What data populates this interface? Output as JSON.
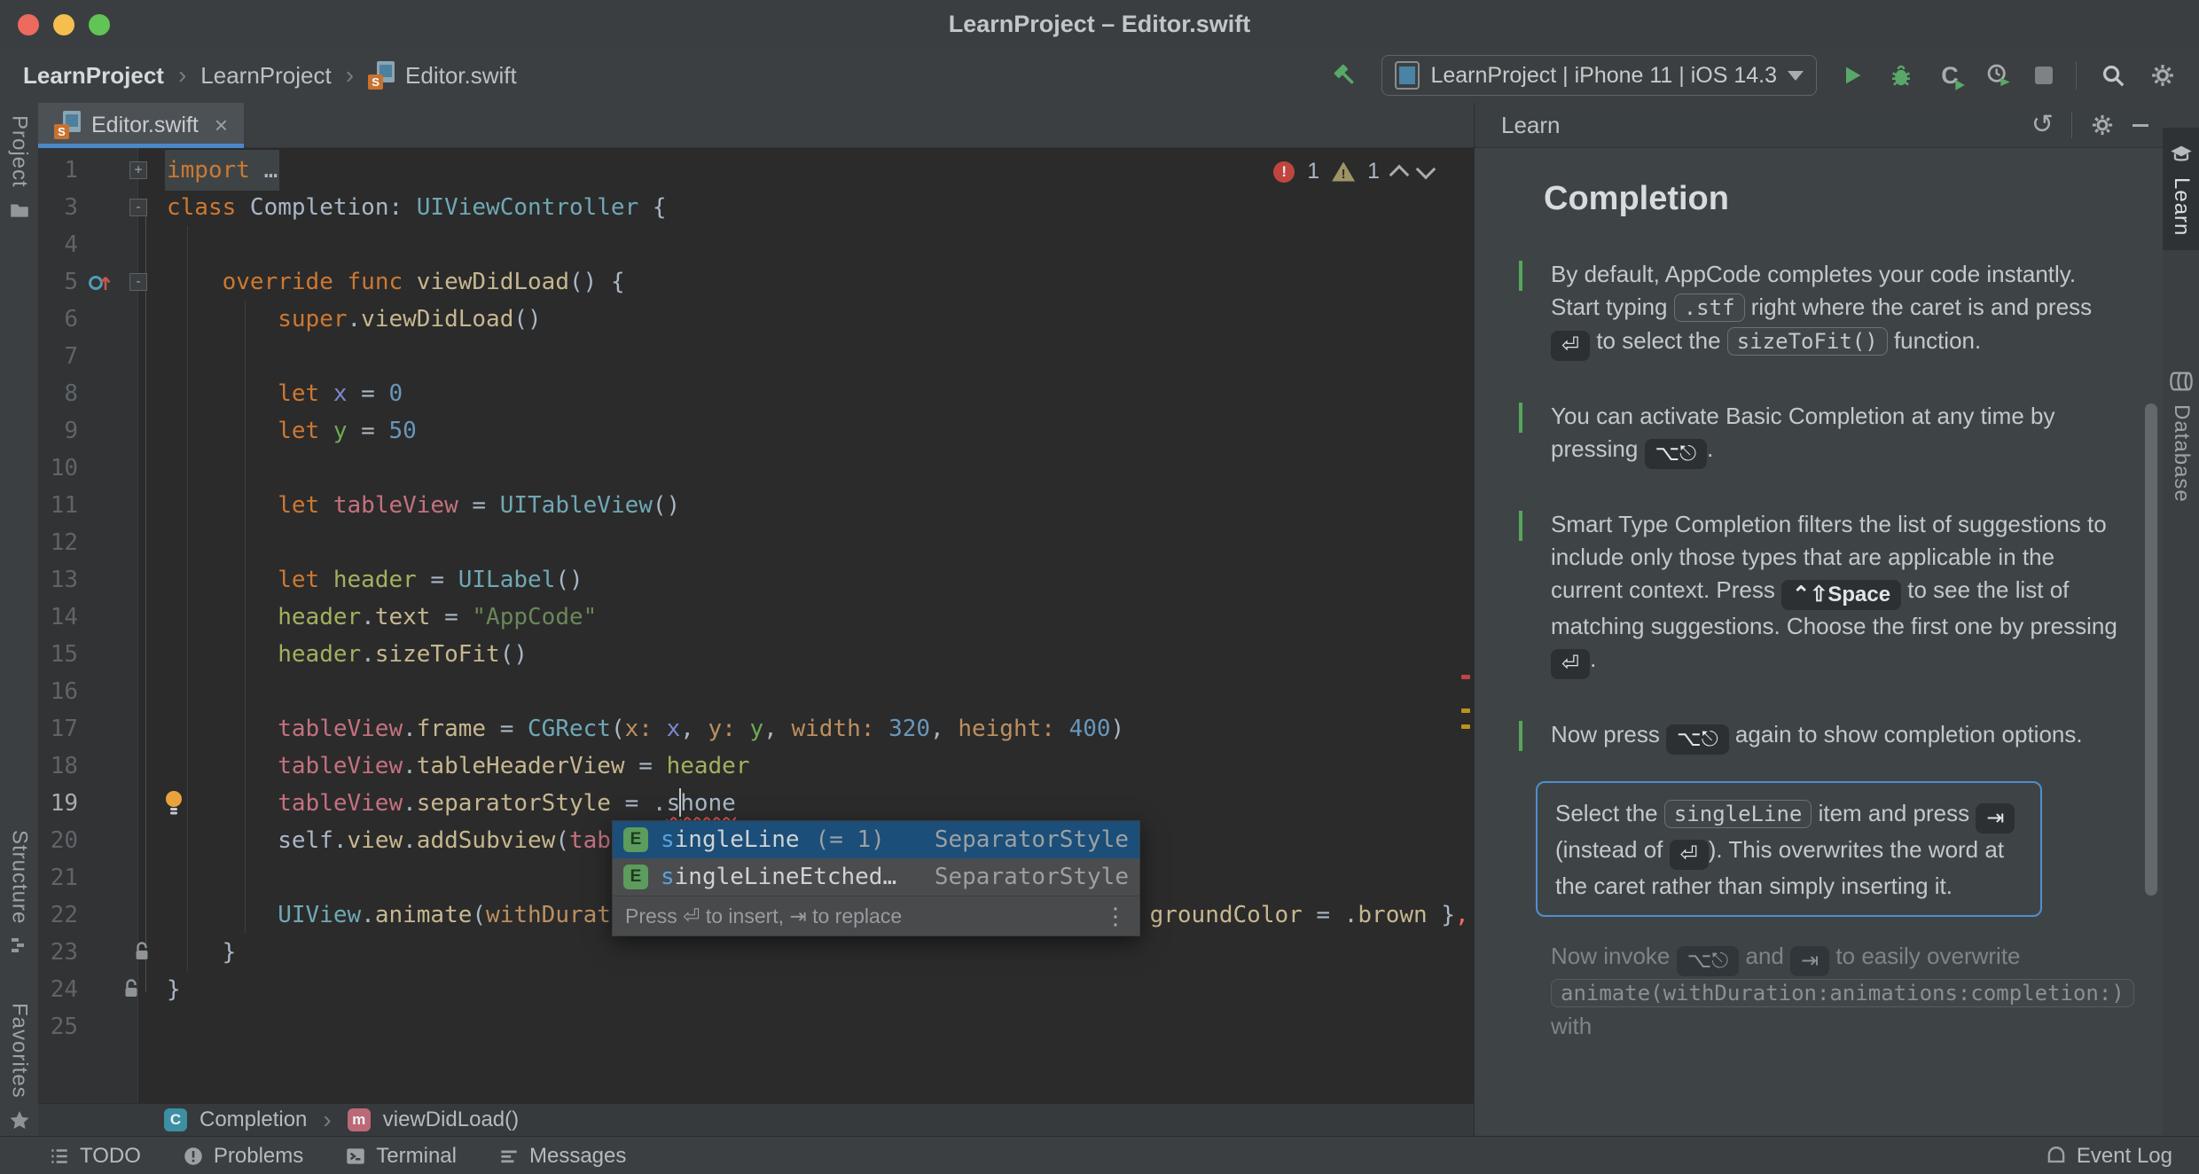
{
  "window": {
    "title": "LearnProject – Editor.swift"
  },
  "colors": {
    "accent_blue": "#4A88C7",
    "selection_blue": "#1B4E78",
    "error_red": "#C0453E",
    "warning_yellow": "#9C9463",
    "run_green": "#59A869",
    "keyword_orange": "#CC7832",
    "editor_background": "#2B2B2B"
  },
  "navbar": {
    "crumbs": [
      "LearnProject",
      "LearnProject",
      "Editor.swift"
    ],
    "run_config": "LearnProject | iPhone 11 | iOS 14.3"
  },
  "strips": {
    "left": [
      "Project",
      "Structure",
      "Favorites"
    ],
    "right": [
      "Learn",
      "Database"
    ]
  },
  "editor": {
    "tab": "Editor.swift",
    "close": "×",
    "errors": "1",
    "warnings": "1",
    "breadcrumbs": [
      {
        "badge": "C",
        "label": "Completion"
      },
      {
        "badge": "m",
        "label": "viewDidLoad()"
      }
    ],
    "lines": [
      {
        "n": "1",
        "fold": "+",
        "hl": true,
        "segs": [
          [
            "k",
            "import"
          ],
          [
            "p",
            " …"
          ]
        ]
      },
      {
        "n": "3",
        "fold": "-",
        "segs": [
          [
            "k",
            "class"
          ],
          [
            "p",
            " Completion: "
          ],
          [
            "t",
            "UIViewController"
          ],
          [
            "p",
            " {"
          ]
        ]
      },
      {
        "n": "4",
        "segs": []
      },
      {
        "n": "5",
        "fold": "-",
        "ovr": true,
        "segs": [
          [
            "p",
            "    "
          ],
          [
            "k",
            "override"
          ],
          [
            "p",
            " "
          ],
          [
            "k",
            "func"
          ],
          [
            "p",
            " "
          ],
          [
            "m",
            "viewDidLoad"
          ],
          [
            "p",
            "() {"
          ]
        ]
      },
      {
        "n": "6",
        "segs": [
          [
            "p",
            "        "
          ],
          [
            "k",
            "super"
          ],
          [
            "p",
            "."
          ],
          [
            "m",
            "viewDidLoad"
          ],
          [
            "p",
            "()"
          ]
        ]
      },
      {
        "n": "7",
        "segs": []
      },
      {
        "n": "8",
        "segs": [
          [
            "p",
            "        "
          ],
          [
            "k",
            "let"
          ],
          [
            "p",
            " "
          ],
          [
            "vx",
            "x"
          ],
          [
            "p",
            " = "
          ],
          [
            "n",
            "0"
          ]
        ]
      },
      {
        "n": "9",
        "segs": [
          [
            "p",
            "        "
          ],
          [
            "k",
            "let"
          ],
          [
            "p",
            " "
          ],
          [
            "vy",
            "y"
          ],
          [
            "p",
            " = "
          ],
          [
            "n",
            "50"
          ]
        ]
      },
      {
        "n": "10",
        "segs": []
      },
      {
        "n": "11",
        "segs": [
          [
            "p",
            "        "
          ],
          [
            "k",
            "let"
          ],
          [
            "p",
            " "
          ],
          [
            "v1",
            "tableView"
          ],
          [
            "p",
            " = "
          ],
          [
            "t",
            "UITableView"
          ],
          [
            "p",
            "()"
          ]
        ]
      },
      {
        "n": "12",
        "segs": []
      },
      {
        "n": "13",
        "segs": [
          [
            "p",
            "        "
          ],
          [
            "k",
            "let"
          ],
          [
            "p",
            " "
          ],
          [
            "v2",
            "header"
          ],
          [
            "p",
            " = "
          ],
          [
            "t",
            "UILabel"
          ],
          [
            "p",
            "()"
          ]
        ]
      },
      {
        "n": "14",
        "segs": [
          [
            "p",
            "        "
          ],
          [
            "v2",
            "header"
          ],
          [
            "p",
            "."
          ],
          [
            "m",
            "text"
          ],
          [
            "p",
            " = "
          ],
          [
            "s",
            "\"AppCode\""
          ]
        ]
      },
      {
        "n": "15",
        "segs": [
          [
            "p",
            "        "
          ],
          [
            "v2",
            "header"
          ],
          [
            "p",
            "."
          ],
          [
            "m",
            "sizeToFit"
          ],
          [
            "p",
            "()"
          ]
        ]
      },
      {
        "n": "16",
        "segs": []
      },
      {
        "n": "17",
        "segs": [
          [
            "p",
            "        "
          ],
          [
            "v1",
            "tableView"
          ],
          [
            "p",
            "."
          ],
          [
            "m",
            "frame"
          ],
          [
            "p",
            " = "
          ],
          [
            "t",
            "CGRect"
          ],
          [
            "p",
            "("
          ],
          [
            "l",
            "x: "
          ],
          [
            "vx",
            "x"
          ],
          [
            "p",
            ", "
          ],
          [
            "l",
            "y: "
          ],
          [
            "vy",
            "y"
          ],
          [
            "p",
            ", "
          ],
          [
            "l",
            "width: "
          ],
          [
            "n",
            "320"
          ],
          [
            "p",
            ", "
          ],
          [
            "l",
            "height: "
          ],
          [
            "n",
            "400"
          ],
          [
            "p",
            ")"
          ]
        ]
      },
      {
        "n": "18",
        "segs": [
          [
            "p",
            "        "
          ],
          [
            "v1",
            "tableView"
          ],
          [
            "p",
            "."
          ],
          [
            "m",
            "tableHeaderView"
          ],
          [
            "p",
            " = "
          ],
          [
            "v2",
            "header"
          ]
        ]
      },
      {
        "n": "19",
        "bulb": true,
        "cur": true,
        "segs": [
          [
            "p",
            "        "
          ],
          [
            "v1",
            "tableView"
          ],
          [
            "p",
            "."
          ],
          [
            "m",
            "separatorStyle"
          ],
          [
            "p",
            " = ."
          ],
          [
            "sq",
            "s"
          ],
          [
            "caret",
            ""
          ],
          [
            "sq",
            "hone"
          ]
        ]
      },
      {
        "n": "20",
        "segs": [
          [
            "p",
            "        "
          ],
          [
            "p",
            "self"
          ],
          [
            "p",
            "."
          ],
          [
            "m",
            "view"
          ],
          [
            "p",
            "."
          ],
          [
            "m",
            "addSubview"
          ],
          [
            "p",
            "("
          ],
          [
            "v1",
            "tabl"
          ]
        ]
      },
      {
        "n": "21",
        "segs": []
      },
      {
        "n": "22",
        "segs": [
          [
            "p",
            "        "
          ],
          [
            "t",
            "UIView"
          ],
          [
            "p",
            "."
          ],
          [
            "m",
            "animate"
          ],
          [
            "p",
            "("
          ],
          [
            "l",
            "withDurati"
          ],
          [
            "gap",
            ""
          ],
          [
            "m",
            "groundColor"
          ],
          [
            "p",
            " = ."
          ],
          [
            "m",
            "brown"
          ],
          [
            "p",
            " }"
          ],
          [
            "e",
            ","
          ]
        ]
      },
      {
        "n": "23",
        "lock": 1,
        "segs": [
          [
            "p",
            "    }"
          ]
        ]
      },
      {
        "n": "24",
        "lock": 2,
        "segs": [
          [
            "p",
            "}"
          ]
        ]
      },
      {
        "n": "25",
        "segs": []
      }
    ]
  },
  "popup": {
    "items": [
      {
        "badge": "E",
        "match": "s",
        "label": "ingleLine",
        "detail": "(= 1)",
        "type": "SeparatorStyle",
        "selected": true
      },
      {
        "badge": "E",
        "match": "s",
        "label": "ingleLineEtched…",
        "detail": "",
        "type": "SeparatorStyle",
        "selected": false
      }
    ],
    "footer": "Press ⏎ to insert, ⇥ to replace",
    "more": "⋮"
  },
  "learn": {
    "panel_title": "Learn",
    "title": "Completion",
    "steps": [
      {
        "parts": [
          {
            "t": "By default, AppCode completes your code instantly. Start typing "
          },
          {
            "chip": ".stf"
          },
          {
            "t": " right where the caret is and press "
          },
          {
            "key": "⏎"
          },
          {
            "t": " to select the "
          },
          {
            "chip": "sizeToFit()"
          },
          {
            "t": " function."
          }
        ]
      },
      {
        "parts": [
          {
            "t": "You can activate Basic Completion at any time by pressing "
          },
          {
            "key": "⌥⎋"
          },
          {
            "t": "."
          }
        ]
      },
      {
        "parts": [
          {
            "t": "Smart Type Completion filters the list of suggestions to include only those types that are applicable in the current context. Press "
          },
          {
            "key": "⌃⇧Space",
            "bold": true
          },
          {
            "t": " to see the list of matching suggestions. Choose the first one by pressing "
          },
          {
            "key": "⏎"
          },
          {
            "t": "."
          }
        ]
      },
      {
        "parts": [
          {
            "t": "Now press "
          },
          {
            "key": "⌥⎋"
          },
          {
            "t": " again to show completion options."
          }
        ]
      }
    ],
    "active": {
      "parts": [
        {
          "t": "Select the "
        },
        {
          "chip": "singleLine"
        },
        {
          "t": " item and press "
        },
        {
          "key": "⇥"
        },
        {
          "t": " (instead of "
        },
        {
          "key": "⏎"
        },
        {
          "t": "). This overwrites the word at the caret rather than simply inserting it."
        }
      ]
    },
    "next": {
      "parts": [
        {
          "t": "Now invoke "
        },
        {
          "key": "⌥⎋"
        },
        {
          "t": " and "
        },
        {
          "key": "⇥"
        },
        {
          "t": " to easily overwrite "
        },
        {
          "chip": "animate(withDuration:animations:completion:)"
        },
        {
          "t": " with"
        }
      ]
    }
  },
  "statusbar": {
    "items": [
      {
        "label": "TODO"
      },
      {
        "label": "Problems"
      },
      {
        "label": "Terminal"
      },
      {
        "label": "Messages"
      }
    ],
    "event_log": "Event Log"
  }
}
